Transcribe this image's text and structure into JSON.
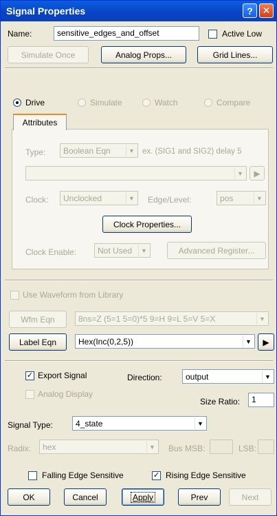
{
  "window": {
    "title": "Signal Properties",
    "help_glyph": "?",
    "close_glyph": "✕"
  },
  "name_row": {
    "label": "Name:",
    "value": "sensitive_edges_and_offset",
    "active_low_label": "Active Low",
    "active_low_checked": false
  },
  "top_buttons": {
    "simulate_once": "Simulate Once",
    "analog_props": "Analog Props...",
    "grid_lines": "Grid Lines..."
  },
  "modes": {
    "drive": "Drive",
    "simulate": "Simulate",
    "watch": "Watch",
    "compare": "Compare",
    "selected": "drive"
  },
  "tab": {
    "label": "Attributes"
  },
  "attributes": {
    "type_label": "Type:",
    "type_value": "Boolean Eqn",
    "type_example": "ex. (SIG1 and SIG2) delay 5",
    "eqn_value": "",
    "clock_label": "Clock:",
    "clock_value": "Unclocked",
    "edge_label": "Edge/Level:",
    "edge_value": "pos",
    "clock_properties": "Clock Properties...",
    "clock_enable_label": "Clock Enable:",
    "clock_enable_value": "Not Used",
    "advanced_register": "Advanced Register..."
  },
  "waveform": {
    "use_library_label": "Use Waveform from Library",
    "wfm_eqn_button": "Wfm Eqn",
    "wfm_eqn_value": "8ns=Z (5=1 5=0)*5 9=H 9=L 5=V 5=X",
    "label_eqn_button": "Label Eqn",
    "label_eqn_value": "Hex(Inc(0,2,5))"
  },
  "export": {
    "export_signal_label": "Export Signal",
    "export_signal_checked": true,
    "analog_display_label": "Analog Display",
    "direction_label": "Direction:",
    "direction_value": "output",
    "size_ratio_label": "Size Ratio:",
    "size_ratio_value": "1"
  },
  "signal_type": {
    "label": "Signal Type:",
    "value": "4_state"
  },
  "bus": {
    "radix_label": "Radix:",
    "radix_value": "hex",
    "bus_msb_label": "Bus MSB:",
    "lsb_label": "LSB:"
  },
  "edges": {
    "falling_label": "Falling Edge Sensitive",
    "falling_checked": false,
    "rising_label": "Rising Edge Sensitive",
    "rising_checked": true
  },
  "bottom_buttons": {
    "ok": "OK",
    "cancel": "Cancel",
    "apply": "Apply",
    "prev": "Prev",
    "next": "Next"
  }
}
